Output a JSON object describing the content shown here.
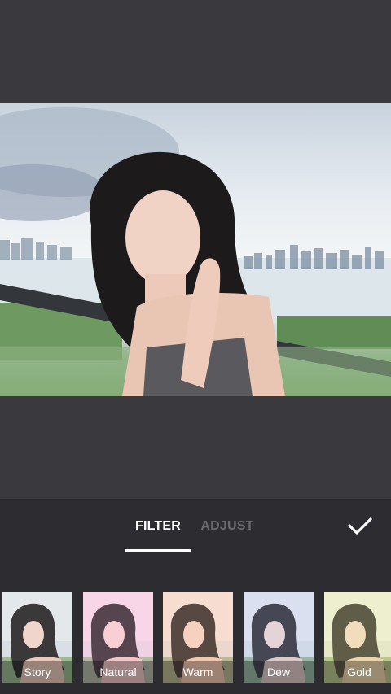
{
  "photo": {
    "alt_subject": "photo-preview"
  },
  "tabs": {
    "filter": "FILTER",
    "adjust": "ADJUST"
  },
  "filters": [
    {
      "label": "Story",
      "tint": "rgba(230,230,235,0.15)"
    },
    {
      "label": "Natural",
      "tint": "rgba(255,200,230,0.25)"
    },
    {
      "label": "Warm",
      "tint": "rgba(255,210,190,0.25)"
    },
    {
      "label": "Dew",
      "tint": "rgba(200,210,240,0.25)"
    },
    {
      "label": "Gold",
      "tint": "rgba(240,240,190,0.3)"
    }
  ],
  "colors": {
    "background": "#3a3a3e",
    "panel": "#2d2d31",
    "active_tab": "#ffffff",
    "inactive_tab": "#6a6a70"
  },
  "icons": {
    "confirm": "check-icon"
  }
}
